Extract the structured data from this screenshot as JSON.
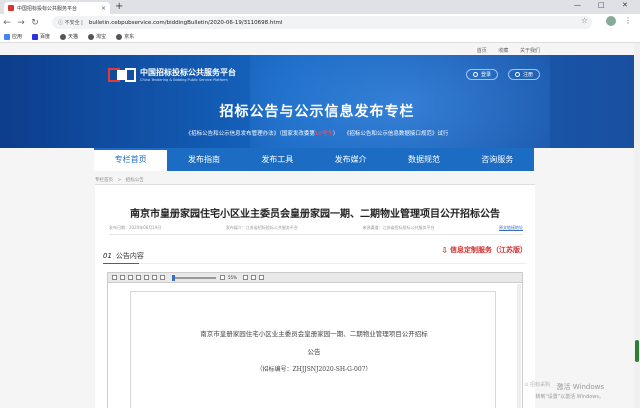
{
  "browser": {
    "tab_title": "中国招标投标公共服务平台",
    "tab_close": "×",
    "new_tab": "+",
    "window_controls": [
      "—",
      "□",
      "✕"
    ],
    "security_label": "ⓘ 不安全 |",
    "url": "bulletin.cebpubservice.com/biddingBulletin/2020-06-19/3110698.html",
    "bookmarks": [
      {
        "label": "应用",
        "icon": "apps-icon",
        "color": "#4285f4"
      },
      {
        "label": "百度",
        "icon": "baidu-icon",
        "color": "#2932e1"
      },
      {
        "label": "天猫",
        "icon": "tmall-icon",
        "color": "#555555"
      },
      {
        "label": "淘宝",
        "icon": "taobao-icon",
        "color": "#555555"
      },
      {
        "label": "京东",
        "icon": "jd-icon",
        "color": "#555555"
      }
    ]
  },
  "site": {
    "toplinks": [
      "首页",
      "收藏",
      "关于我们"
    ],
    "logo_cn": "中国招标投标公共服务平台",
    "logo_en": "China Tendering & Bidding Public Service Platform",
    "login": "登录",
    "register": "注册",
    "banner_title": "招标公告与公示信息发布专栏",
    "banner_sub_1": "《招标公告和公示信息发布管理办法》（国家发改委第",
    "banner_sub_red": "10号令",
    "banner_sub_2": "）　　《招标公告和公示信息数据接口规范》试行",
    "nav": [
      "专栏首页",
      "发布指南",
      "发布工具",
      "发布媒介",
      "数据规范",
      "咨询服务"
    ],
    "breadcrumb": "专栏首页　>　招标公告",
    "brand_color": "#1c6cc4"
  },
  "article": {
    "title": "南京市皇册家园住宅小区业主委员会皇册家园一期、二期物业管理项目公开招标公告",
    "meta_date": "发布日期：2020年06月19日",
    "meta_source": "发布媒介：江苏省招标投标公共服务平台",
    "meta_platform": "来源渠道：江苏省招标投标公共服务平台",
    "meta_link": "原文链接地址",
    "section_num": "01",
    "section_label": "公告内容",
    "custom_service": "信息定制服务（江苏版）",
    "pdf_zoom": "55%",
    "pdf_line1": "南京市皇册家园住宅小区业主委员会皇册家园一期、二期物业管理项目公开招标",
    "pdf_line2": "公告",
    "pdf_line3": "（招标编号：ZHJJSNJ2020-SH-G-007）"
  },
  "overlay": {
    "activate_title": "激活 Windows",
    "activate_sub": "转到\"设置\"以激活 Windows。",
    "wechat_mark": "⊙ 招标采购"
  }
}
